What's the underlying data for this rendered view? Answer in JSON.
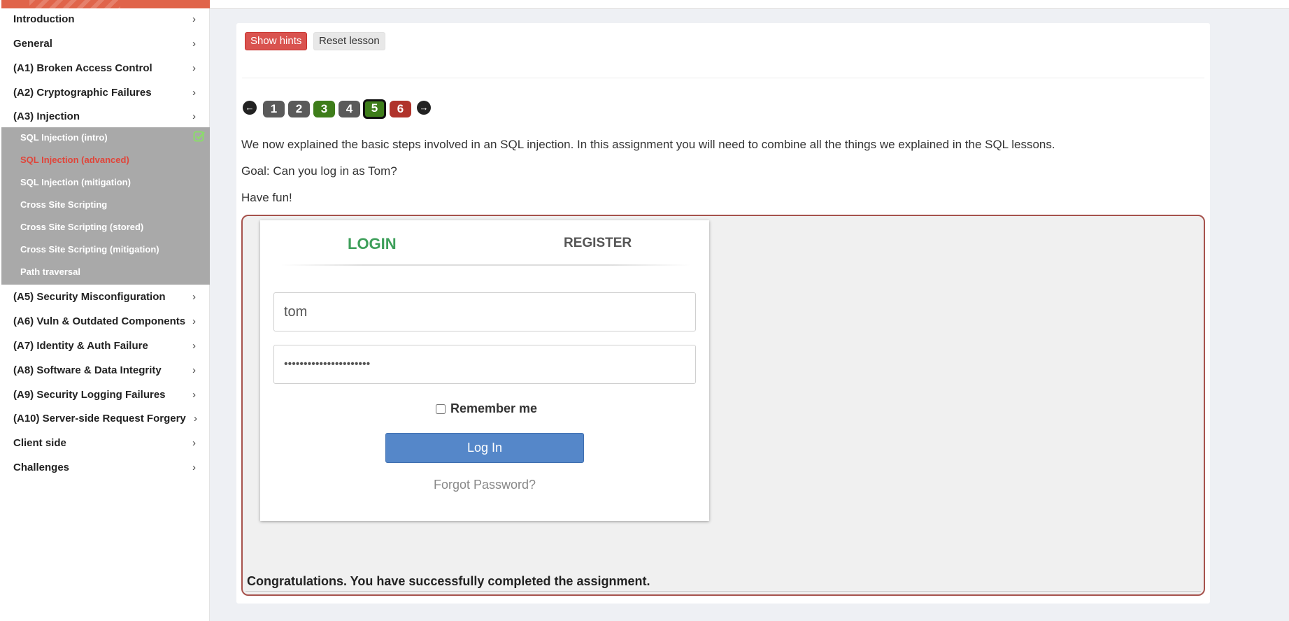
{
  "sidebar": {
    "categories": [
      {
        "label": "Introduction"
      },
      {
        "label": "General"
      },
      {
        "label": "(A1) Broken Access Control"
      },
      {
        "label": "(A2) Cryptographic Failures"
      },
      {
        "label": "(A3) Injection"
      },
      {
        "label": "(A5) Security Misconfiguration"
      },
      {
        "label": "(A6) Vuln & Outdated Components"
      },
      {
        "label": "(A7) Identity & Auth Failure"
      },
      {
        "label": "(A8) Software & Data Integrity"
      },
      {
        "label": "(A9) Security Logging Failures"
      },
      {
        "label": "(A10) Server-side Request Forgery"
      },
      {
        "label": "Client side"
      },
      {
        "label": "Challenges"
      }
    ],
    "chevron": "›",
    "injection_lessons": [
      {
        "label": "SQL Injection (intro)",
        "completed": true
      },
      {
        "label": "SQL Injection (advanced)",
        "active": true
      },
      {
        "label": "SQL Injection (mitigation)"
      },
      {
        "label": "Cross Site Scripting"
      },
      {
        "label": "Cross Site Scripting (stored)"
      },
      {
        "label": "Cross Site Scripting (mitigation)"
      },
      {
        "label": "Path traversal"
      }
    ]
  },
  "toolbar": {
    "show_hints": "Show hints",
    "reset_lesson": "Reset lesson"
  },
  "pager": {
    "prev_icon": "arrow-left-icon",
    "next_icon": "arrow-right-icon",
    "pages": [
      {
        "label": "1",
        "color": "#5a5a5a"
      },
      {
        "label": "2",
        "color": "#5a5a5a"
      },
      {
        "label": "3",
        "color": "#3e7d1a"
      },
      {
        "label": "4",
        "color": "#5a5a5a"
      },
      {
        "label": "5",
        "color": "#3e7d1a",
        "current": true
      },
      {
        "label": "6",
        "color": "#b0332b"
      }
    ]
  },
  "lesson": {
    "intro": "We now explained the basic steps involved in an SQL injection. In this assignment you will need to combine all the things we explained in the SQL lessons.",
    "goal": "Goal: Can you log in as Tom?",
    "fun": "Have fun!"
  },
  "login_form": {
    "tab_login": "LOGIN",
    "tab_register": "REGISTER",
    "username_value": "tom",
    "password_value": "••••••••••••••••••••••",
    "remember_label": "Remember me",
    "login_button": "Log In",
    "forgot_link": "Forgot Password?"
  },
  "feedback": "Congratulations. You have successfully completed the assignment.",
  "colors": {
    "accent_red": "#d9534f",
    "brand_band": "#e0644a",
    "login_green": "#3e9f5a",
    "login_button": "#5587c9"
  }
}
